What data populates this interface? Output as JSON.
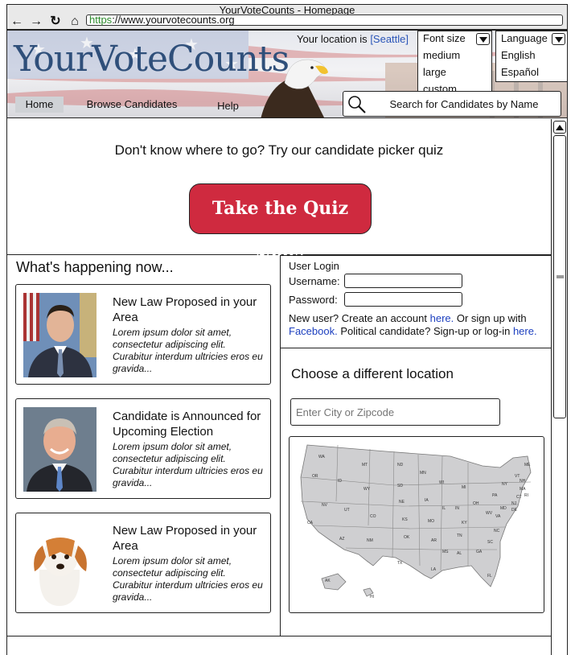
{
  "window": {
    "title": "YourVoteCounts - Homepage"
  },
  "browser": {
    "url_scheme": "https",
    "url_rest": "://www.yourvotecounts.org",
    "icons": [
      "back-icon",
      "forward-icon",
      "reload-icon",
      "home-icon"
    ]
  },
  "header": {
    "logo": "YourVoteCounts",
    "location_prefix": "Your location is",
    "location_city": "[Seattle]",
    "font_size": {
      "label": "Font size",
      "options": [
        "medium",
        "large",
        "custom"
      ]
    },
    "language": {
      "label": "Language",
      "options": [
        "English",
        "Español"
      ]
    },
    "tabs": [
      "Home",
      "Browse Candidates",
      "Help"
    ],
    "search_placeholder": "Search for Candidates by Name"
  },
  "quiz": {
    "prompt": "Don't know where to go? Try our candidate picker quiz",
    "button": "Take the Quiz Now!"
  },
  "news": {
    "title": "What's happening now...",
    "items": [
      {
        "title": "New Law Proposed in your Area",
        "body": "Lorem ipsum dolor sit amet, consectetur adipiscing elit. Curabitur interdum ultricies eros eu gravida..."
      },
      {
        "title": "Candidate is Announced for Upcoming Election",
        "body": "Lorem ipsum dolor sit amet, consectetur adipiscing elit. Curabitur interdum ultricies eros eu gravida..."
      },
      {
        "title": "New Law Proposed in your Area",
        "body": "Lorem ipsum dolor sit amet, consectetur adipiscing elit. Curabitur interdum ultricies eros eu gravida..."
      }
    ]
  },
  "login": {
    "title": "User Login",
    "username_label": "Username:",
    "password_label": "Password:",
    "note_1": "New user? Create an account ",
    "link_here_1": "here.",
    "note_2": " Or sign up with ",
    "link_facebook": "Facebook.",
    "note_3": " Political candidate? Sign-up or log-in ",
    "link_here_2": "here."
  },
  "location": {
    "title": "Choose a different location",
    "input_placeholder": "Enter City or Zipcode",
    "states": [
      "WA",
      "MT",
      "ND",
      "MN",
      "ME",
      "OR",
      "ID",
      "SD",
      "WI",
      "MI",
      "NY",
      "VT",
      "NH",
      "MA",
      "RI",
      "CT",
      "NJ",
      "PA",
      "DE",
      "MD",
      "WY",
      "NE",
      "IA",
      "IL",
      "IN",
      "OH",
      "WV",
      "VA",
      "NV",
      "UT",
      "CO",
      "KS",
      "MO",
      "KY",
      "NC",
      "CA",
      "AZ",
      "NM",
      "OK",
      "AR",
      "TN",
      "SC",
      "TX",
      "MS",
      "AL",
      "GA",
      "LA",
      "FL",
      "AK",
      "HI"
    ]
  }
}
